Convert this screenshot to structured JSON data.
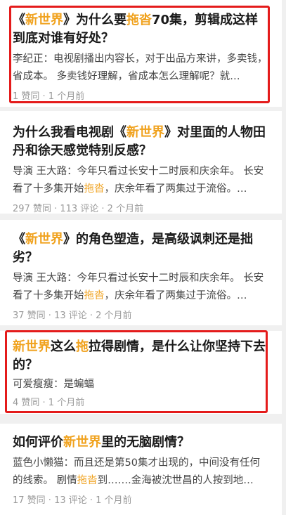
{
  "cards": [
    {
      "title": [
        {
          "text": "《"
        },
        {
          "text": "新世界",
          "hl": true
        },
        {
          "text": "》为什么要"
        },
        {
          "text": "拖沓",
          "hl": true
        },
        {
          "text": "70集，剪辑成这样到底对谁有好处？"
        }
      ],
      "excerpt": "李纪正：电视剧播出内容长，对于出品方来讲，多卖钱，省成本。 多卖钱好理解，省成本怎么理解呢？就…",
      "meta": "1 赞同 · 1 个月前"
    },
    {
      "title": [
        {
          "text": "为什么我看电视剧《"
        },
        {
          "text": "新世界",
          "hl": true
        },
        {
          "text": "》对里面的人物田丹和徐天感觉特别反感？"
        }
      ],
      "excerpt": [
        {
          "text": "导演 王大路：今年只看过长安十二时辰和庆余年。 长安看了十多集开始"
        },
        {
          "text": "拖沓",
          "hl": true
        },
        {
          "text": "，庆余年看了两集过于流俗。…"
        }
      ],
      "meta": "297 赞同 · 113 评论 · 2 个月前"
    },
    {
      "title": [
        {
          "text": "《"
        },
        {
          "text": "新世界",
          "hl": true
        },
        {
          "text": "》的角色塑造，是高级讽刺还是拙劣？"
        }
      ],
      "excerpt": [
        {
          "text": "导演 王大路：今年只看过长安十二时辰和庆余年。 长安看了十多集开始"
        },
        {
          "text": "拖沓",
          "hl": true
        },
        {
          "text": "，庆余年看了两集过于流俗。…"
        }
      ],
      "meta": "37 赞同 · 13 评论 · 2 个月前"
    },
    {
      "title": [
        {
          "text": "新世界",
          "hl": true
        },
        {
          "text": "这么"
        },
        {
          "text": "拖",
          "hl": true
        },
        {
          "text": "拉得剧情，是什么让你坚持下去的？"
        }
      ],
      "excerpt": "可爱瘦瘦：是蝙蝠",
      "meta": "4 赞同 · 1 个月前"
    },
    {
      "title": [
        {
          "text": "如何评价"
        },
        {
          "text": "新世界",
          "hl": true
        },
        {
          "text": "里的无脑剧情？"
        }
      ],
      "excerpt": [
        {
          "text": "蓝色小懒猫：而且还是第50集才出现的，中间没有任何的线索。 剧情"
        },
        {
          "text": "拖沓",
          "hl": true
        },
        {
          "text": "到…….金海被沈世昌的人按到地…"
        }
      ],
      "meta": "17 赞同 · 13 评论 · 1 个月前"
    }
  ]
}
